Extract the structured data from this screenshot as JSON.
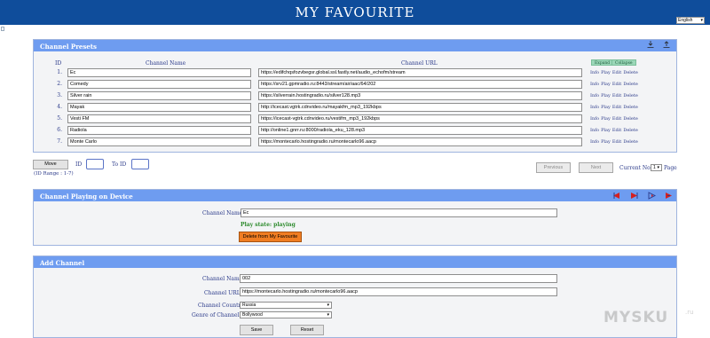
{
  "header": {
    "title": "MY FAVOURITE",
    "language": "English"
  },
  "presets": {
    "title": "Channel Presets",
    "col_id": "ID",
    "col_name": "Channel Name",
    "col_url": "Channel URL",
    "expand_label": "Expand",
    "collapse_label": "Collapse",
    "actions": [
      "Info",
      "Play",
      "Edit",
      "Delete"
    ],
    "rows": [
      {
        "id": "1.",
        "name": "Ec",
        "url": "https://edifchqsfozvbegsr.global.ssl.fastly.net/audio_echofm/stream"
      },
      {
        "id": "2.",
        "name": "Comedy",
        "url": "https://srv21.gpmradio.ru:8443/stream/air/aac/64/202"
      },
      {
        "id": "3.",
        "name": "Silver rain",
        "url": "https://silverrain.hostingradio.ru/silver128.mp3"
      },
      {
        "id": "4.",
        "name": "Mayak",
        "url": "http://icecast.vgtrk.cdnvideo.ru/mayakfm_mp3_192kbps"
      },
      {
        "id": "5.",
        "name": "Vesti FM",
        "url": "https://icecast-vgtrk.cdnvideo.ru/vestifm_mp3_192kbps"
      },
      {
        "id": "6.",
        "name": "Radiola",
        "url": "http://online1.gnrr.ru:8000/radiola_eku_128.mp3"
      },
      {
        "id": "7.",
        "name": "Monte Carlo",
        "url": "https://montecarlo.hostingradio.ru/montecarlo96.aacp"
      }
    ]
  },
  "move": {
    "move_label": "Move",
    "id_label": "ID",
    "to_id_label": "To ID",
    "range_label": "(ID Range : 1-7)",
    "previous_label": "Previous",
    "next_label": "Next",
    "current_no_label": "Current No.",
    "current_no_value": "1",
    "page_label": "Page"
  },
  "playing": {
    "title": "Channel Playing on Device",
    "channel_name_label": "Channel Name",
    "channel_name_value": "Ec",
    "play_state": "Play state: playing",
    "delete_label": "Delete from My Favourite"
  },
  "add": {
    "title": "Add Channel",
    "name_label": "Channel Name",
    "name_value": "002",
    "url_label": "Channel URL",
    "url_value": "https://montecarlo.hostingradio.ru/montecarlo96.aacp",
    "country_label": "Channel Country",
    "country_value": "Russia",
    "genre_label": "Genre of Channel",
    "genre_value": "Bollywood",
    "save_label": "Save",
    "reset_label": "Reset"
  },
  "watermark": {
    "text": "MYSKU",
    "suffix": ".ru"
  },
  "colors": {
    "banner": "#0f4d9b",
    "panel_header": "#6e9cf0",
    "delete_button": "#f07d22",
    "arrow_red": "#d42020",
    "arrow_blue": "#2b3a8a"
  },
  "icons": [
    "download-icon",
    "upload-icon",
    "previous-arrow-icon",
    "next-arrow-icon",
    "volume-down-icon",
    "volume-up-icon"
  ]
}
